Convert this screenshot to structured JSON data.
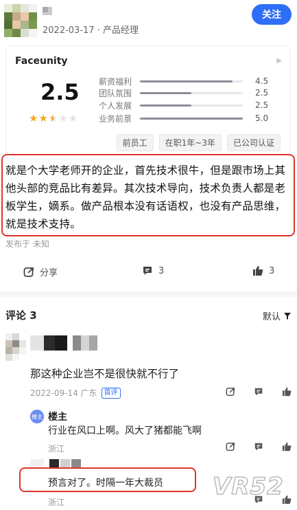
{
  "header": {
    "post_meta": "2022-03-17 · 产品经理",
    "follow_label": "关注"
  },
  "rating_card": {
    "company": "Faceunity",
    "score": "2.5",
    "stars": {
      "filled": 2,
      "half": 1,
      "empty": 2
    },
    "subscores": [
      {
        "label": "薪资福利",
        "value": "4.5",
        "fill": 0.9
      },
      {
        "label": "团队氛围",
        "value": "2.5",
        "fill": 0.5
      },
      {
        "label": "个人发展",
        "value": "2.5",
        "fill": 0.5
      },
      {
        "label": "业务前景",
        "value": "5.0",
        "fill": 1.0
      }
    ],
    "tags": [
      "前员工",
      "在职1年~3年",
      "已公司认证"
    ]
  },
  "review": {
    "text": "就是个大学老师开的企业，首先技术很牛，但是跟市场上其他头部的竞品比有差异。其次技术导向，技术负责人都是老板学生，嫡系。做产品根本没有话语权，也没有产品思维，就是技术支持。",
    "published": "发布于 未知"
  },
  "actions": {
    "share_label": "分享",
    "comment_count": "3",
    "like_count": "3"
  },
  "comments": {
    "title": "评论 3",
    "sort_label": "默认",
    "items": [
      {
        "text": "那这种企业岂不是很快就不行了",
        "meta": "2022-09-14 广东",
        "badge": "首评",
        "replies": [
          {
            "avatar_label": "楼主",
            "name": "楼主",
            "text": "行业在风口上啊。风大了猪都能飞啊",
            "location": "浙江"
          },
          {
            "text": "预言对了。时隔一年大裁员",
            "location": "浙江"
          }
        ]
      }
    ]
  },
  "watermark": "VR52",
  "colors": {
    "accent": "#2f6ef6",
    "highlight_box": "#e0342b",
    "star": "#f5a623"
  }
}
